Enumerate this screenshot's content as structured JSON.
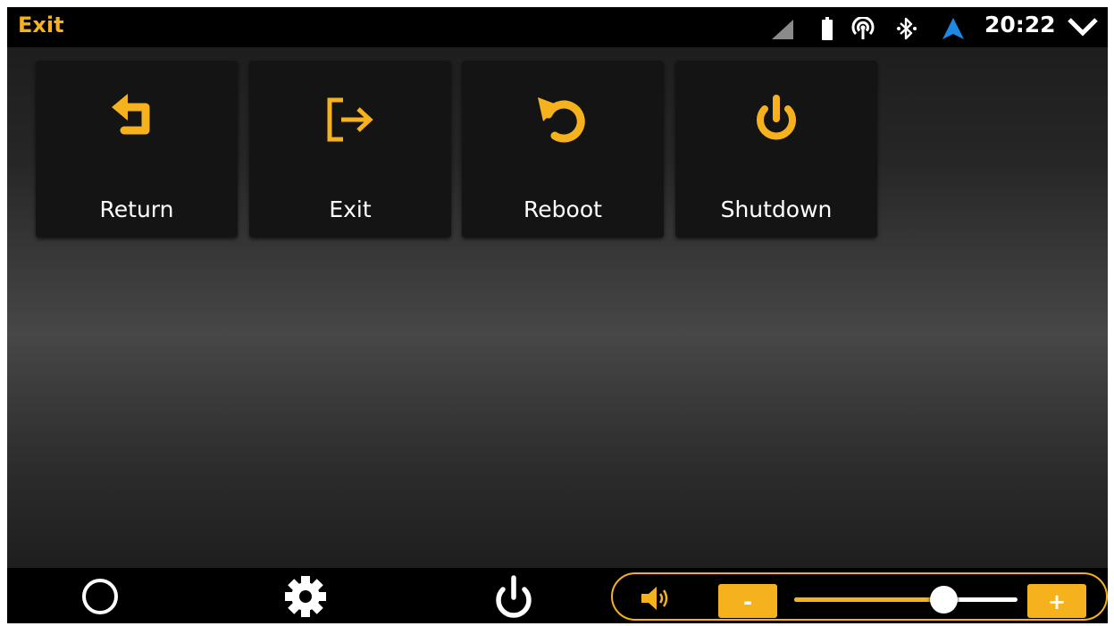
{
  "status_bar": {
    "title": "Exit",
    "clock": "20:22",
    "icons": [
      "cellular-signal-icon",
      "battery-icon",
      "hotspot-icon",
      "bluetooth-icon",
      "navigation-icon",
      "chevron-down-icon"
    ]
  },
  "tiles": [
    {
      "label": "Return",
      "icon": "return-arrow-icon"
    },
    {
      "label": "Exit",
      "icon": "exit-door-icon"
    },
    {
      "label": "Reboot",
      "icon": "reboot-icon"
    },
    {
      "label": "Shutdown",
      "icon": "power-icon"
    }
  ],
  "bottom_bar": {
    "nav_icons": [
      "home-circle-icon",
      "settings-gear-icon",
      "power-icon"
    ],
    "volume": {
      "icon": "speaker-icon",
      "minus_label": "-",
      "plus_label": "+",
      "level": 0.67
    }
  },
  "colors": {
    "accent": "#f6b21c",
    "tile_background": "#141414",
    "bar_background": "#000000",
    "navigation_arrow": "#1e88e5"
  }
}
